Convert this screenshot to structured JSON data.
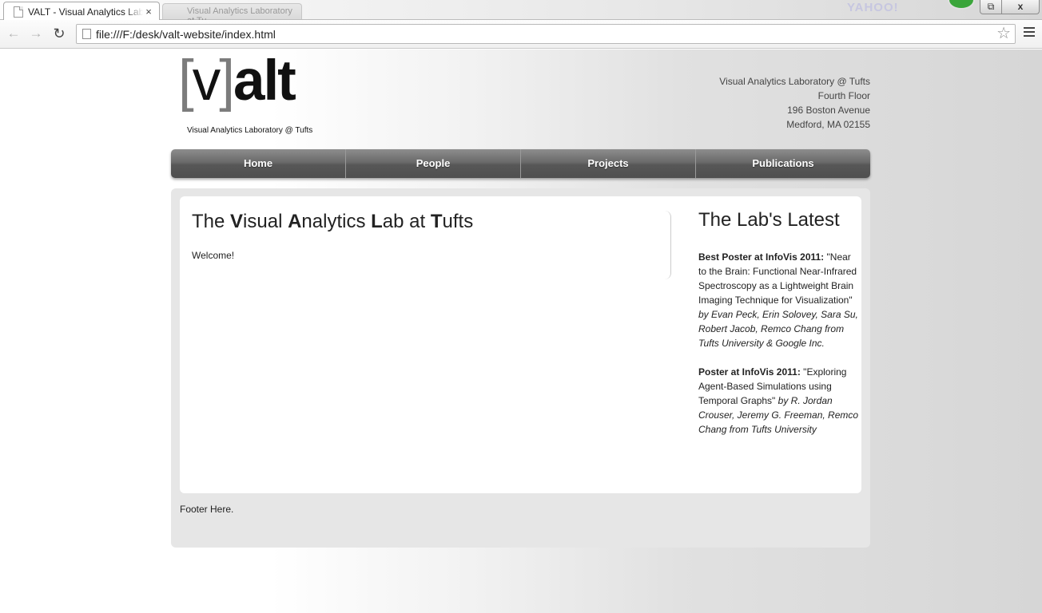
{
  "browser": {
    "active_tab_title": "VALT - Visual Analytics Lab",
    "inactive_tab_title": "Visual Analytics Laboratory at Tu...",
    "close_glyph": "×",
    "url": "file:///F:/desk/valt-website/index.html",
    "yahoo_badge": "YAHOO!",
    "back_icon": "arrow-left-icon",
    "forward_icon": "arrow-right-icon",
    "reload_icon": "reload-icon",
    "star_icon": "star-icon",
    "menu_icon": "hamburger-menu-icon",
    "window_restore": "⧉",
    "window_close": "x"
  },
  "logo": {
    "bracket_open": "[",
    "letter_v": "v",
    "bracket_close": "]",
    "letters_alt": "alt",
    "subtitle": "Visual Analytics Laboratory @ Tufts"
  },
  "address": {
    "line1": "Visual Analytics Laboratory @ Tufts",
    "line2": "Fourth Floor",
    "line3": "196 Boston Avenue",
    "line4": "Medford, MA 02155"
  },
  "nav": {
    "home": "Home",
    "people": "People",
    "projects": "Projects",
    "publications": "Publications"
  },
  "main": {
    "title": {
      "p1": "The ",
      "b1": "V",
      "p2": "isual ",
      "b2": "A",
      "p3": "nalytics ",
      "b3": "L",
      "p4": "ab at ",
      "b4": "T",
      "p5": "ufts"
    },
    "welcome": "Welcome!"
  },
  "sidebar": {
    "title": "The Lab's Latest",
    "news": [
      {
        "label": "Best Poster at InfoVis 2011:",
        "text": " \"Near to the Brain: Functional Near-Infrared Spectroscopy as a Lightweight Brain Imaging Technique for Visualization\"",
        "authors": " by Evan Peck, Erin Solovey, Sara Su, Robert Jacob, Remco Chang from Tufts University & Google Inc."
      },
      {
        "label": "Poster at InfoVis 2011:",
        "text": " \"Exploring Agent-Based Simulations using Temporal Graphs\"",
        "authors": " by R. Jordan Crouser, Jeremy G. Freeman, Remco Chang from Tufts University"
      }
    ]
  },
  "footer": {
    "text": "Footer Here."
  },
  "colors": {
    "nav_gradient_top": "#8d8d8d",
    "nav_gradient_bottom": "#4f4f4f",
    "content_bg": "#e6e6e6",
    "logo_bracket": "#7c7c7c"
  }
}
